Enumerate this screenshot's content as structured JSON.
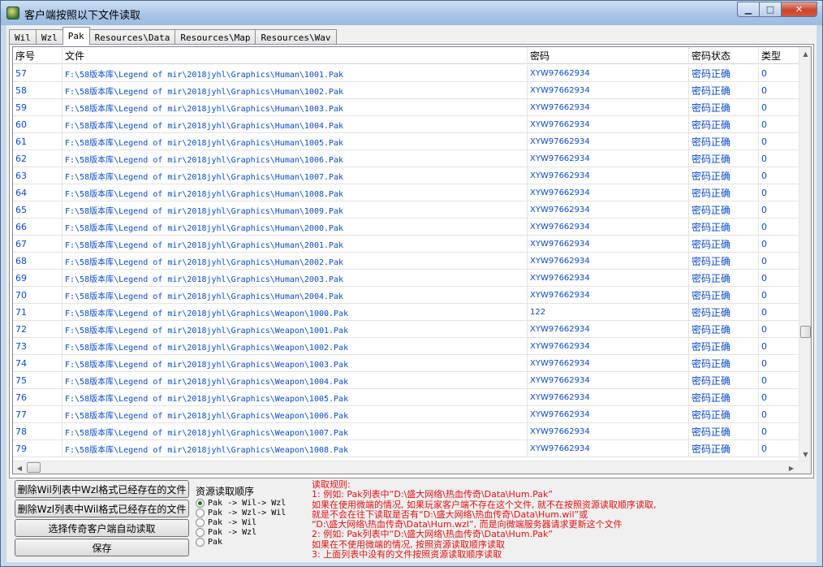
{
  "window": {
    "title": "客户端按照以下文件读取"
  },
  "tabs": [
    {
      "label": "Wil",
      "active": false
    },
    {
      "label": "Wzl",
      "active": false
    },
    {
      "label": "Pak",
      "active": true
    },
    {
      "label": "Resources\\Data",
      "active": false
    },
    {
      "label": "Resources\\Map",
      "active": false
    },
    {
      "label": "Resources\\Wav",
      "active": false
    }
  ],
  "list": {
    "columns": [
      "序号",
      "文件",
      "密码",
      "密码状态",
      "类型"
    ],
    "rows": [
      [
        "57",
        "F:\\58版本库\\Legend of mir\\2018jyhl\\Graphics\\Human\\1001.Pak",
        "XYW97662934",
        "密码正确",
        "0"
      ],
      [
        "58",
        "F:\\58版本库\\Legend of mir\\2018jyhl\\Graphics\\Human\\1002.Pak",
        "XYW97662934",
        "密码正确",
        "0"
      ],
      [
        "59",
        "F:\\58版本库\\Legend of mir\\2018jyhl\\Graphics\\Human\\1003.Pak",
        "XYW97662934",
        "密码正确",
        "0"
      ],
      [
        "60",
        "F:\\58版本库\\Legend of mir\\2018jyhl\\Graphics\\Human\\1004.Pak",
        "XYW97662934",
        "密码正确",
        "0"
      ],
      [
        "61",
        "F:\\58版本库\\Legend of mir\\2018jyhl\\Graphics\\Human\\1005.Pak",
        "XYW97662934",
        "密码正确",
        "0"
      ],
      [
        "62",
        "F:\\58版本库\\Legend of mir\\2018jyhl\\Graphics\\Human\\1006.Pak",
        "XYW97662934",
        "密码正确",
        "0"
      ],
      [
        "63",
        "F:\\58版本库\\Legend of mir\\2018jyhl\\Graphics\\Human\\1007.Pak",
        "XYW97662934",
        "密码正确",
        "0"
      ],
      [
        "64",
        "F:\\58版本库\\Legend of mir\\2018jyhl\\Graphics\\Human\\1008.Pak",
        "XYW97662934",
        "密码正确",
        "0"
      ],
      [
        "65",
        "F:\\58版本库\\Legend of mir\\2018jyhl\\Graphics\\Human\\1009.Pak",
        "XYW97662934",
        "密码正确",
        "0"
      ],
      [
        "66",
        "F:\\58版本库\\Legend of mir\\2018jyhl\\Graphics\\Human\\2000.Pak",
        "XYW97662934",
        "密码正确",
        "0"
      ],
      [
        "67",
        "F:\\58版本库\\Legend of mir\\2018jyhl\\Graphics\\Human\\2001.Pak",
        "XYW97662934",
        "密码正确",
        "0"
      ],
      [
        "68",
        "F:\\58版本库\\Legend of mir\\2018jyhl\\Graphics\\Human\\2002.Pak",
        "XYW97662934",
        "密码正确",
        "0"
      ],
      [
        "69",
        "F:\\58版本库\\Legend of mir\\2018jyhl\\Graphics\\Human\\2003.Pak",
        "XYW97662934",
        "密码正确",
        "0"
      ],
      [
        "70",
        "F:\\58版本库\\Legend of mir\\2018jyhl\\Graphics\\Human\\2004.Pak",
        "XYW97662934",
        "密码正确",
        "0"
      ],
      [
        "71",
        "F:\\58版本库\\Legend of mir\\2018jyhl\\Graphics\\Weapon\\1000.Pak",
        "122",
        "密码正确",
        "0"
      ],
      [
        "72",
        "F:\\58版本库\\Legend of mir\\2018jyhl\\Graphics\\Weapon\\1001.Pak",
        "XYW97662934",
        "密码正确",
        "0"
      ],
      [
        "73",
        "F:\\58版本库\\Legend of mir\\2018jyhl\\Graphics\\Weapon\\1002.Pak",
        "XYW97662934",
        "密码正确",
        "0"
      ],
      [
        "74",
        "F:\\58版本库\\Legend of mir\\2018jyhl\\Graphics\\Weapon\\1003.Pak",
        "XYW97662934",
        "密码正确",
        "0"
      ],
      [
        "75",
        "F:\\58版本库\\Legend of mir\\2018jyhl\\Graphics\\Weapon\\1004.Pak",
        "XYW97662934",
        "密码正确",
        "0"
      ],
      [
        "76",
        "F:\\58版本库\\Legend of mir\\2018jyhl\\Graphics\\Weapon\\1005.Pak",
        "XYW97662934",
        "密码正确",
        "0"
      ],
      [
        "77",
        "F:\\58版本库\\Legend of mir\\2018jyhl\\Graphics\\Weapon\\1006.Pak",
        "XYW97662934",
        "密码正确",
        "0"
      ],
      [
        "78",
        "F:\\58版本库\\Legend of mir\\2018jyhl\\Graphics\\Weapon\\1007.Pak",
        "XYW97662934",
        "密码正确",
        "0"
      ],
      [
        "79",
        "F:\\58版本库\\Legend of mir\\2018jyhl\\Graphics\\Weapon\\1008.Pak",
        "XYW97662934",
        "密码正确",
        "0"
      ]
    ]
  },
  "buttons": {
    "delete_wil": "删除Wil列表中Wzl格式已经存在的文件",
    "delete_wzl": "删除Wzl列表中Wil格式已经存在的文件",
    "auto_read": "选择传奇客户端自动读取",
    "save": "保存"
  },
  "order": {
    "title": "资源读取顺序",
    "options": [
      {
        "label": "Pak -> Wil-> Wzl",
        "selected": true
      },
      {
        "label": "Pak -> Wzl-> Wil",
        "selected": false
      },
      {
        "label": "Pak -> Wil",
        "selected": false
      },
      {
        "label": "Pak -> Wzl",
        "selected": false
      },
      {
        "label": "Pak",
        "selected": false
      }
    ]
  },
  "rules": [
    "读取规则:",
    "1: 例如: Pak列表中“D:\\盛大网络\\热血传奇\\Data\\Hum.Pak”",
    "    如果在使用微端的情况, 如果玩家客户端不存在这个文件, 就不在按照资源读取顺序读取,",
    "    就是不会在往下读取是否有“D:\\盛大网络\\热血传奇\\Data\\Hum.wil”或",
    "    “D:\\盛大网络\\热血传奇\\Data\\Hum.wzl”, 而是向微端服务器请求更新这个文件",
    "2: 例如: Pak列表中“D:\\盛大网络\\热血传奇\\Data\\Hum.Pak”",
    "    如果在不使用微端的情况, 按照资源读取顺序读取",
    "3: 上面列表中没有的文件按照资源读取顺序读取"
  ],
  "colors": {
    "link_blue": "#0a4bd0",
    "rules_red": "#e01010"
  }
}
